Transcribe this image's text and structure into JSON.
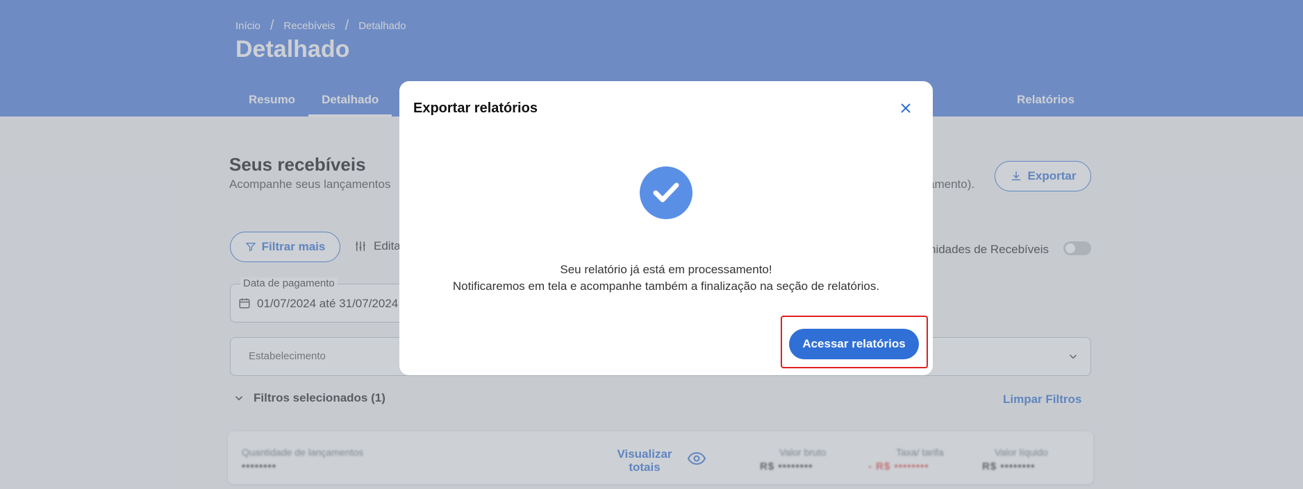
{
  "breadcrumb": {
    "items": [
      "Início",
      "Recebíveis",
      "Detalhado"
    ],
    "separator": "/"
  },
  "page_title": "Detalhado",
  "tabs": {
    "items": [
      "Resumo",
      "Detalhado"
    ],
    "right": "Relatórios"
  },
  "section": {
    "title": "Seus recebíveis",
    "subtitle_left": "Acompanhe seus lançamentos",
    "subtitle_right": "amento).",
    "export_label": "Exportar"
  },
  "filters": {
    "filtrar_label": "Filtrar mais",
    "editar_label": "Edita",
    "toggle_label": "nidades de Recebíveis",
    "date_label": "Data de pagamento",
    "date_value": "01/07/2024 até 31/07/2024",
    "estabelecimento_label": "Estabelecimento",
    "selected_label": "Filtros selecionados (1)",
    "clear_label": "Limpar Filtros"
  },
  "summary": {
    "qty_label": "Quantidade de lançamentos",
    "qty_value": "••••••••",
    "visualizar_label": "Visualizar totais",
    "bruto_label": "Valor bruto",
    "bruto_value": "R$ ••••••••",
    "taxa_label": "Taxa/ tarifa",
    "taxa_value": "- R$ ••••••••",
    "liquido_label": "Valor líquido",
    "liquido_value": "R$ ••••••••"
  },
  "modal": {
    "title": "Exportar relatórios",
    "message_line1": "Seu relatório já está em processamento!",
    "message_line2": "Notificaremos em tela e acompanhe também a finalização na seção de relatórios.",
    "button_label": "Acessar relatórios"
  },
  "colors": {
    "header": "#4a7be0",
    "primary": "#2f6fd6",
    "check": "#5a8fe6",
    "highlight": "#e02020",
    "negative": "#e34b4b"
  },
  "icons": [
    "close-icon",
    "check-icon",
    "download-icon",
    "filter-icon",
    "sliders-icon",
    "calendar-icon",
    "chevron-down-icon",
    "eye-icon"
  ]
}
